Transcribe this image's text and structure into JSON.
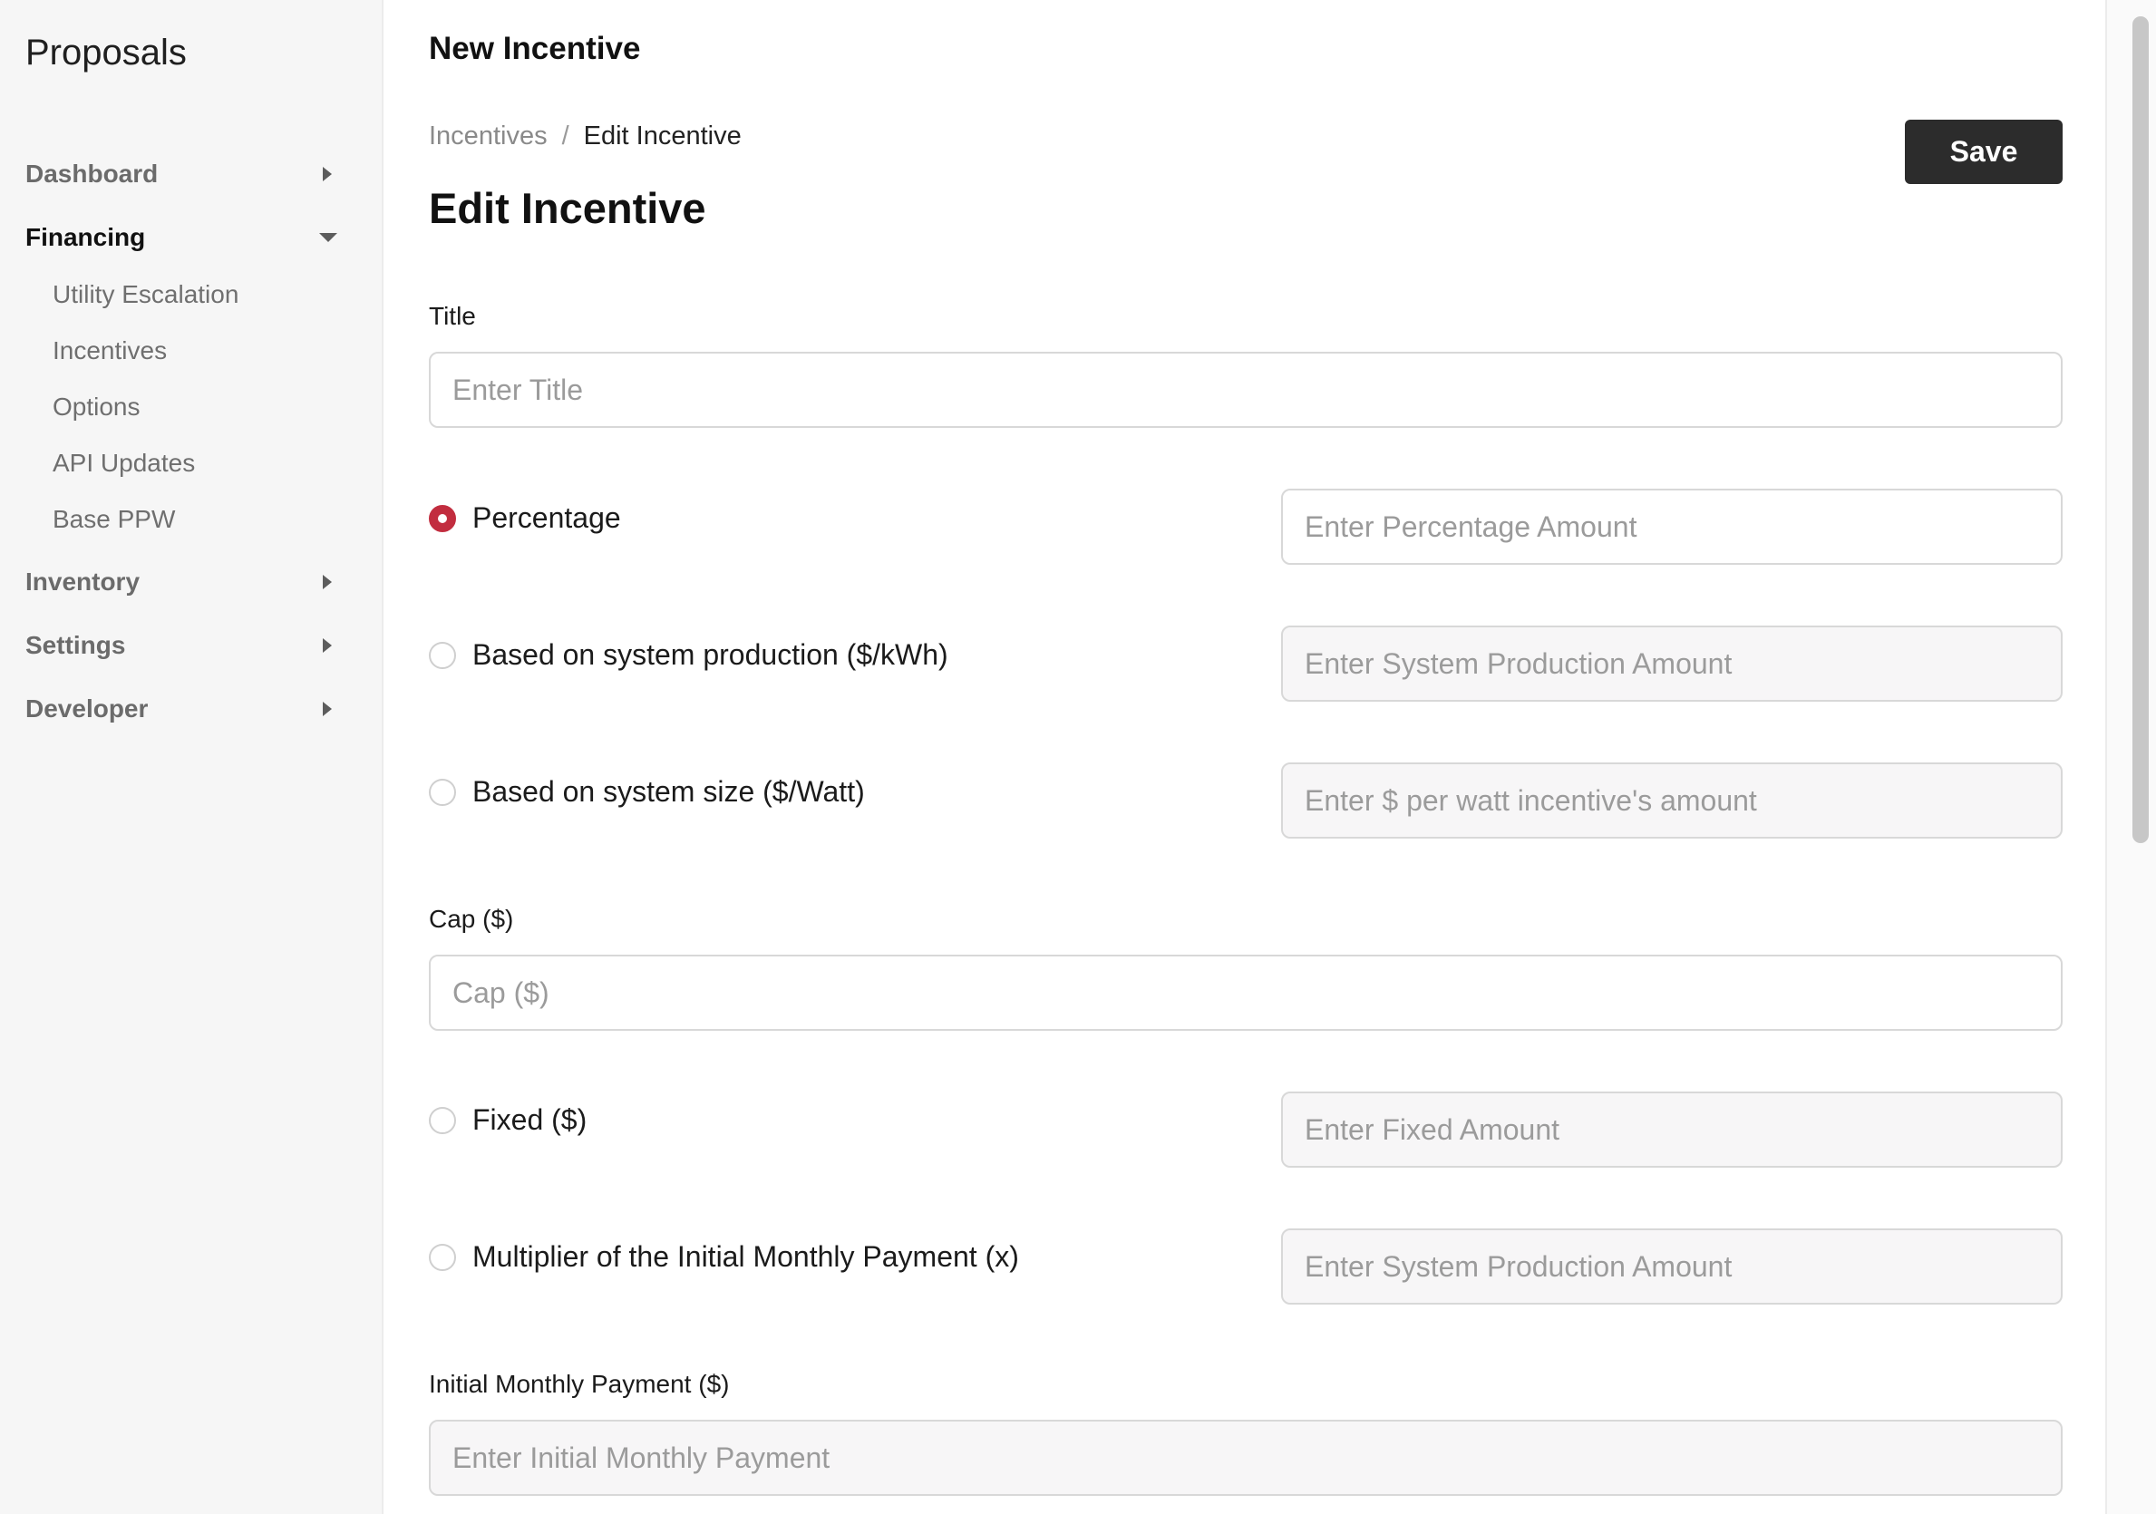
{
  "sidebar": {
    "brand": "Proposals",
    "nav": [
      {
        "label": "Dashboard"
      },
      {
        "label": "Financing"
      },
      {
        "label": "Inventory"
      },
      {
        "label": "Settings"
      },
      {
        "label": "Developer"
      }
    ],
    "financing_sub": [
      {
        "label": "Utility Escalation"
      },
      {
        "label": "Incentives"
      },
      {
        "label": "Options"
      },
      {
        "label": "API Updates"
      },
      {
        "label": "Base PPW"
      }
    ]
  },
  "header": {
    "title": "New Incentive",
    "save_label": "Save"
  },
  "breadcrumb": {
    "parent": "Incentives",
    "separator": "/",
    "current": "Edit Incentive"
  },
  "page": {
    "title": "Edit Incentive"
  },
  "form": {
    "title_label": "Title",
    "title_placeholder": "Enter Title",
    "options": [
      {
        "label": "Percentage",
        "placeholder": "Enter Percentage Amount",
        "selected": true
      },
      {
        "label": "Based on system production ($/kWh)",
        "placeholder": "Enter System Production Amount",
        "selected": false
      },
      {
        "label": "Based on system size ($/Watt)",
        "placeholder": "Enter $ per watt incentive's amount",
        "selected": false
      }
    ],
    "cap_label": "Cap ($)",
    "cap_placeholder": "Cap ($)",
    "options2": [
      {
        "label": "Fixed ($)",
        "placeholder": "Enter Fixed Amount",
        "selected": false
      },
      {
        "label": "Multiplier of the Initial Monthly Payment (x)",
        "placeholder": "Enter System Production Amount",
        "selected": false
      }
    ],
    "imp_label": "Initial Monthly Payment ($)",
    "imp_placeholder": "Enter Initial Monthly Payment"
  },
  "colors": {
    "accent": "#c22d3f",
    "save_button": "#2c2c2c"
  }
}
